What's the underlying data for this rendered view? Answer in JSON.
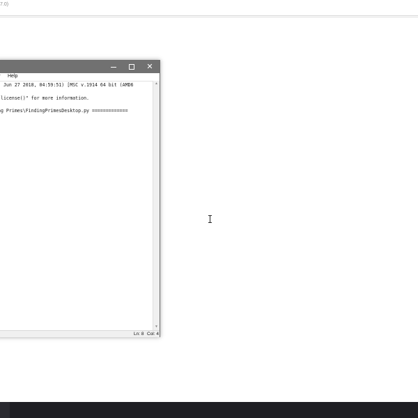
{
  "background_window": {
    "title_fragment": "7.0)"
  },
  "shell": {
    "titlebar": {
      "minimize_label": "",
      "maximize_label": "",
      "close_label": "✕"
    },
    "menubar": {
      "partial_item": "v",
      "help": "Help"
    },
    "lines": [
      ", Jun 27 2018, 04:59:51) [MSC v.1914 64 bit (AMD6",
      "\"license()\" for more information.",
      "ng Primes\\FindingPrimesDesktop.py ============="
    ],
    "statusbar": {
      "line": "Ln: 8",
      "col": "Col: 4"
    }
  },
  "colors": {
    "titlebar": "#717171",
    "taskbar": "#1f1f24",
    "page_background": "#ffffff"
  },
  "icons": {
    "minimize": "minimize-icon",
    "maximize": "maximize-icon",
    "close": "close-icon",
    "cursor": "text-cursor-icon"
  }
}
